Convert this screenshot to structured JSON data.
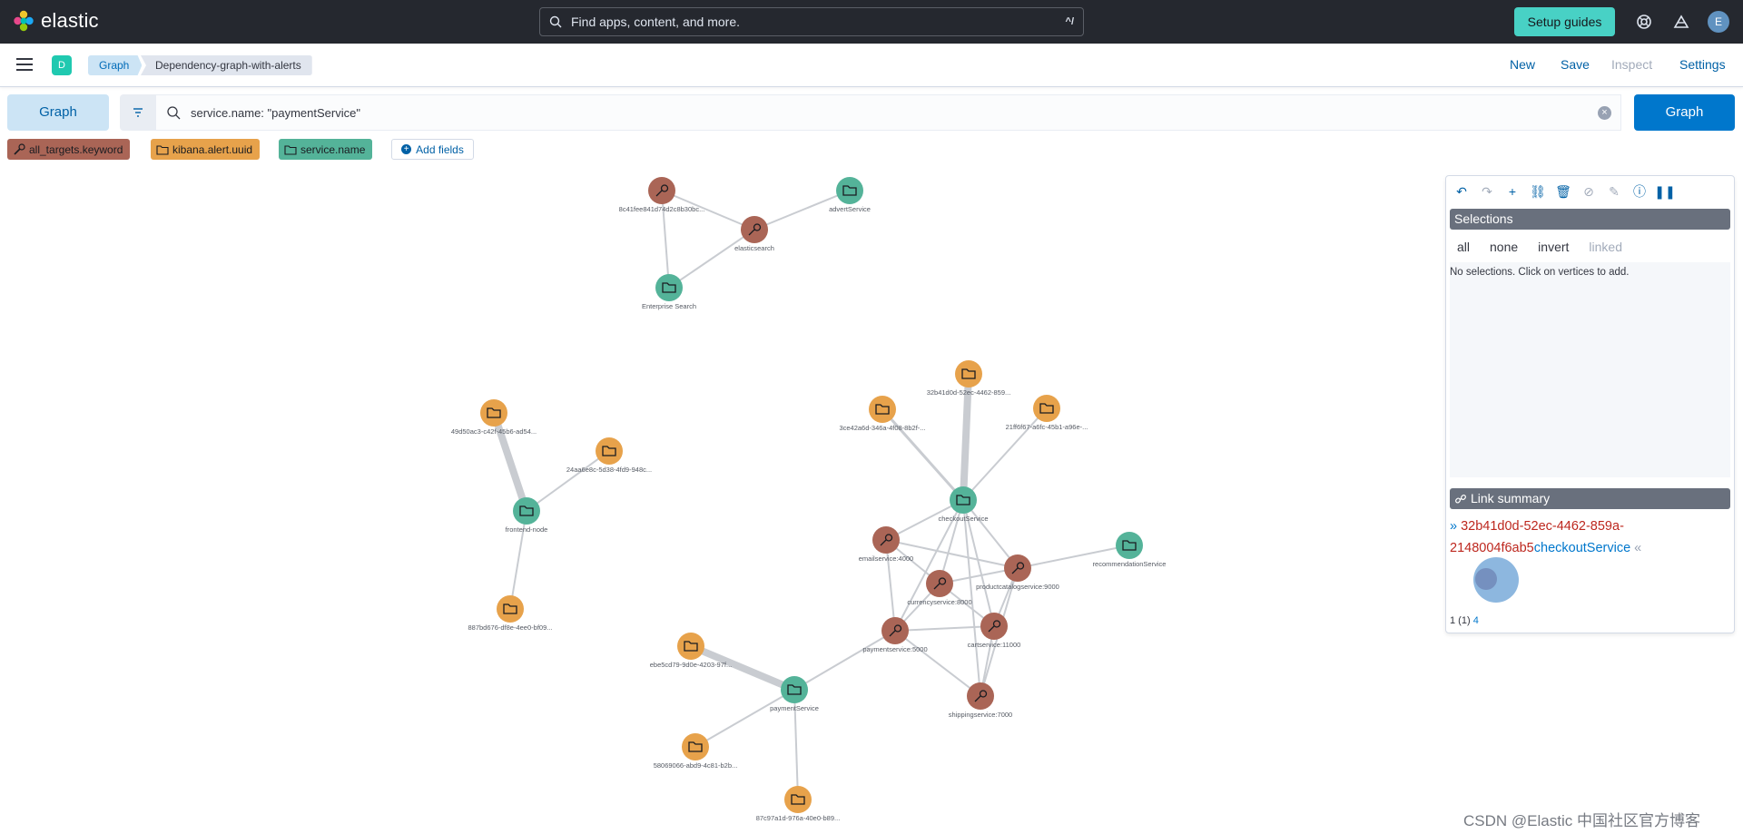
{
  "app": {
    "name": "elastic"
  },
  "header": {
    "search_placeholder": "Find apps, content, and more.",
    "search_shortcut": "^/",
    "setup_guides": "Setup guides",
    "user_initial": "E"
  },
  "nav": {
    "space_initial": "D",
    "breadcrumbs": [
      "Graph",
      "Dependency-graph-with-alerts"
    ],
    "links": {
      "new": "New",
      "save": "Save",
      "inspect": "Inspect",
      "settings": "Settings"
    }
  },
  "query": {
    "tab_label": "Graph",
    "value": "service.name: \"paymentService\"",
    "submit": "Graph"
  },
  "fields": [
    {
      "label": "all_targets.keyword",
      "icon": "wrench-icon",
      "color": "#aa6556"
    },
    {
      "label": "kibana.alert.uuid",
      "icon": "folder-icon",
      "color": "#e7a24b"
    },
    {
      "label": "service.name",
      "icon": "folder-icon",
      "color": "#54b399"
    }
  ],
  "add_fields": "Add fields",
  "graph": {
    "colors": {
      "service": "#54b399",
      "target": "#aa6556",
      "alert": "#e7a24b"
    },
    "nodes": [
      {
        "id": "es-id",
        "label": "8c41fee841d74d2c8b30bc...",
        "type": "target"
      },
      {
        "id": "elasticsearch",
        "label": "elasticsearch",
        "type": "target"
      },
      {
        "id": "advertService",
        "label": "advertService",
        "type": "service"
      },
      {
        "id": "enterprise",
        "label": "Enterprise Search",
        "type": "service"
      },
      {
        "id": "a1",
        "label": "49d50ac3-c42f-45b6-ad54...",
        "type": "alert"
      },
      {
        "id": "a2",
        "label": "24aa6e8c-5d38-4fd9-948c...",
        "type": "alert"
      },
      {
        "id": "frontend",
        "label": "frontend-node",
        "type": "service"
      },
      {
        "id": "a3",
        "label": "887bd676-df8e-4ee0-bf09...",
        "type": "alert"
      },
      {
        "id": "a4",
        "label": "32b41d0d-52ec-4462-859...",
        "type": "alert"
      },
      {
        "id": "a5",
        "label": "3ce42a6d-346a-4f08-8b2f-...",
        "type": "alert"
      },
      {
        "id": "a6",
        "label": "21ff6f67-a6fc-45b1-a96e-...",
        "type": "alert"
      },
      {
        "id": "checkout",
        "label": "checkoutService",
        "type": "service"
      },
      {
        "id": "email",
        "label": "emailservice:4000",
        "type": "target"
      },
      {
        "id": "currency",
        "label": "currencyservice:8000",
        "type": "target"
      },
      {
        "id": "productcatalog",
        "label": "productcatalogservice:9000",
        "type": "target"
      },
      {
        "id": "recommendation",
        "label": "recommendationService",
        "type": "service"
      },
      {
        "id": "paymentsvc",
        "label": "paymentservice:5000",
        "type": "target"
      },
      {
        "id": "cart",
        "label": "cartservice:11000",
        "type": "target"
      },
      {
        "id": "shipping",
        "label": "shippingservice:7000",
        "type": "target"
      },
      {
        "id": "a7",
        "label": "ebe5cd79-9d0e-4203-97f...",
        "type": "alert"
      },
      {
        "id": "payment",
        "label": "paymentService",
        "type": "service"
      },
      {
        "id": "a8",
        "label": "58069066-abd9-4c81-b2b...",
        "type": "alert"
      },
      {
        "id": "a9",
        "label": "87c97a1d-976a-40e0-b89...",
        "type": "alert"
      }
    ],
    "edges": [
      [
        "es-id",
        "elasticsearch",
        2
      ],
      [
        "es-id",
        "enterprise",
        2
      ],
      [
        "elasticsearch",
        "advertService",
        2
      ],
      [
        "elasticsearch",
        "enterprise",
        2
      ],
      [
        "a1",
        "frontend",
        8
      ],
      [
        "a2",
        "frontend",
        2
      ],
      [
        "a3",
        "frontend",
        2
      ],
      [
        "a4",
        "checkout",
        8
      ],
      [
        "a5",
        "checkout",
        3
      ],
      [
        "a6",
        "checkout",
        2
      ],
      [
        "checkout",
        "email",
        2
      ],
      [
        "checkout",
        "currency",
        2
      ],
      [
        "checkout",
        "productcatalog",
        2
      ],
      [
        "checkout",
        "paymentsvc",
        2
      ],
      [
        "checkout",
        "cart",
        2
      ],
      [
        "checkout",
        "shipping",
        2
      ],
      [
        "email",
        "currency",
        2
      ],
      [
        "email",
        "paymentsvc",
        2
      ],
      [
        "email",
        "productcatalog",
        2
      ],
      [
        "currency",
        "paymentsvc",
        2
      ],
      [
        "currency",
        "cart",
        2
      ],
      [
        "currency",
        "productcatalog",
        2
      ],
      [
        "productcatalog",
        "recommendation",
        2
      ],
      [
        "productcatalog",
        "cart",
        2
      ],
      [
        "productcatalog",
        "shipping",
        2
      ],
      [
        "paymentsvc",
        "cart",
        2
      ],
      [
        "paymentsvc",
        "shipping",
        2
      ],
      [
        "cart",
        "shipping",
        2
      ],
      [
        "a7",
        "payment",
        8
      ],
      [
        "payment",
        "paymentsvc",
        2
      ],
      [
        "a8",
        "payment",
        2
      ],
      [
        "a9",
        "payment",
        2
      ]
    ]
  },
  "panel": {
    "selections_title": "Selections",
    "select_links": [
      "all",
      "none",
      "invert",
      "linked"
    ],
    "no_selection": "No selections. Click on vertices to add.",
    "link_summary_title": "Link summary",
    "link_source": "32b41d0d-52ec-4462-859a-2148004f6ab5",
    "link_target": "checkoutService",
    "pager": {
      "text": "1 (1)",
      "total": "4"
    }
  },
  "watermark": "CSDN @Elastic 中国社区官方博客"
}
